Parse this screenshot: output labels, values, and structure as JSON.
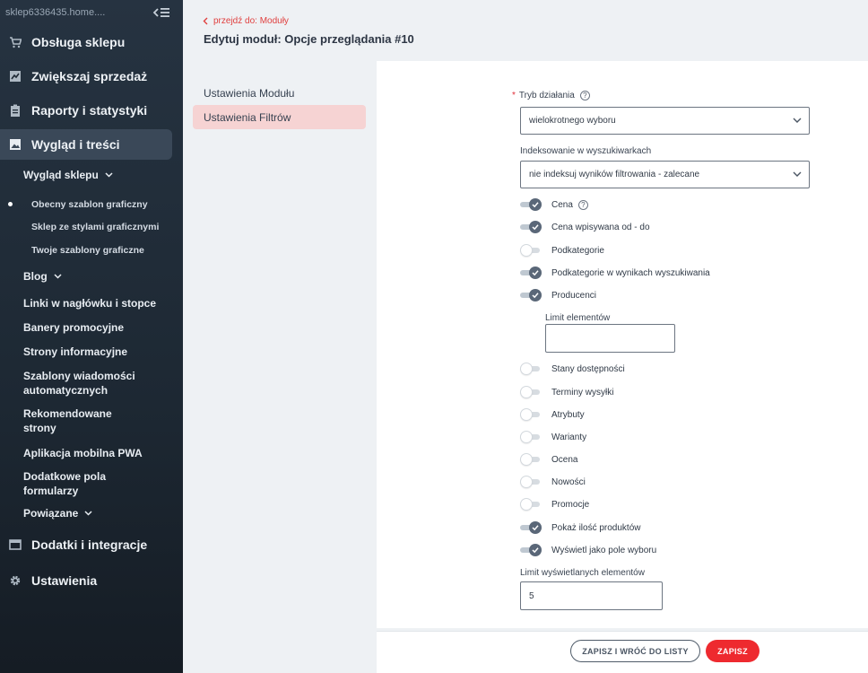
{
  "sidebar": {
    "domain": "sklep6336435.home....",
    "items": [
      {
        "label": "Obsługa sklepu",
        "icon": "cart-icon"
      },
      {
        "label": "Zwiększaj sprzedaż",
        "icon": "chart-icon"
      },
      {
        "label": "Raporty i statystyki",
        "icon": "clipboard-icon"
      },
      {
        "label": "Wygląd i treści",
        "icon": "image-icon"
      },
      {
        "label": "Dodatki i integracje",
        "icon": "window-icon"
      },
      {
        "label": "Ustawienia",
        "icon": "gear-icon"
      }
    ],
    "appearance": {
      "shop_look": "Wygląd sklepu",
      "current_template": "Obecny szablon graficzny",
      "style_shop": "Sklep ze stylami graficznymi",
      "your_templates": "Twoje szablony graficzne",
      "blog": "Blog",
      "links": "Linki w nagłówku i stopce",
      "banners": "Banery promocyjne",
      "info_pages": "Strony informacyjne",
      "auto_messages_1": "Szablony wiadomości",
      "auto_messages_2": "automatycznych",
      "recommended_1": "Rekomendowane",
      "recommended_2": "strony",
      "pwa": "Aplikacja mobilna PWA",
      "extra_fields_1": "Dodatkowe pola",
      "extra_fields_2": "formularzy",
      "related": "Powiązane"
    }
  },
  "header": {
    "back_link": "przejdź do: Moduły",
    "title": "Edytuj moduł: Opcje przeglądania #10"
  },
  "subnav": {
    "module_settings": "Ustawienia Modułu",
    "filter_settings": "Ustawienia Filtrów"
  },
  "form": {
    "mode_label": "Tryb działania",
    "mode_required": "*",
    "mode_value": "wielokrotnego wyboru",
    "indexing_label": "Indeksowanie w wyszukiwarkach",
    "indexing_value": "nie indeksuj wyników filtrowania - zalecane",
    "toggles": [
      {
        "label": "Cena",
        "on": true
      },
      {
        "label": "Cena wpisywana od - do",
        "on": true
      },
      {
        "label": "Podkategorie",
        "on": false
      },
      {
        "label": "Podkategorie w wynikach wyszukiwania",
        "on": true
      },
      {
        "label": "Producenci",
        "on": true
      },
      {
        "label": "Stany dostępności",
        "on": false
      },
      {
        "label": "Terminy wysyłki",
        "on": false
      },
      {
        "label": "Atrybuty",
        "on": false
      },
      {
        "label": "Warianty",
        "on": false
      },
      {
        "label": "Ocena",
        "on": false
      },
      {
        "label": "Nowości",
        "on": false
      },
      {
        "label": "Promocje",
        "on": false
      },
      {
        "label": "Pokaż ilość produktów",
        "on": true
      },
      {
        "label": "Wyświetl jako pole wyboru",
        "on": true
      }
    ],
    "producer_limit_label": "Limit elementów",
    "producer_limit_value": "",
    "display_limit_label": "Limit wyświetlanych elementów",
    "display_limit_value": "5"
  },
  "footer": {
    "save_back_label": "ZAPISZ I WRÓĆ DO LISTY",
    "save_label": "ZAPISZ"
  },
  "colors": {
    "accent": "#ee2a2f",
    "sidebar_bg": "#1d2833",
    "active_subnav": "#f6d3d3"
  }
}
